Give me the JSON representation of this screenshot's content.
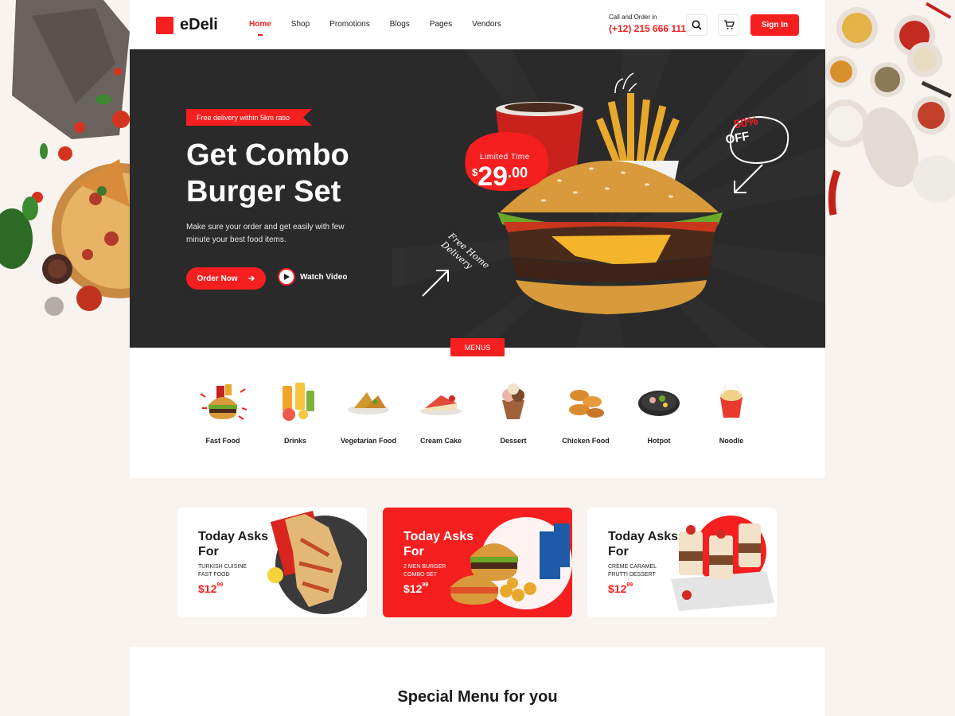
{
  "brand": {
    "name": "eDeli",
    "accent": "#f51f1f"
  },
  "nav": {
    "items": [
      {
        "label": "Home",
        "active": true
      },
      {
        "label": "Shop"
      },
      {
        "label": "Promotions"
      },
      {
        "label": "Blogs"
      },
      {
        "label": "Pages"
      },
      {
        "label": "Vendors"
      }
    ]
  },
  "header": {
    "call_label": "Call and Order in",
    "phone": "(+12) 215 666 111",
    "search_icon": "search-icon",
    "cart_icon": "cart-icon",
    "signin_label": "Sign In"
  },
  "hero": {
    "tag": "Free delivery within 5km ratio",
    "title_line1": "Get Combo",
    "title_line2": "Burger Set",
    "description": "Make sure your order and get easily with few minute your best food items.",
    "order_label": "Order Now",
    "watch_label": "Watch Video",
    "price_label": "Limited Time",
    "price_currency": "$",
    "price_dollars": "29",
    "price_cents": ".00",
    "off_percent": "50%",
    "off_label": "OFF",
    "delivery_note_line1": "Free Home",
    "delivery_note_line2": "Delivery"
  },
  "menus_tab": "MENUS",
  "categories": [
    {
      "label": "Fast Food"
    },
    {
      "label": "Drinks"
    },
    {
      "label": "Vegetarian Food"
    },
    {
      "label": "Cream Cake"
    },
    {
      "label": "Dessert"
    },
    {
      "label": "Chicken Food"
    },
    {
      "label": "Hotpot"
    },
    {
      "label": "Noodle"
    }
  ],
  "promos": [
    {
      "title": "Today Asks For",
      "sub_line1": "TURKISH CUISINE",
      "sub_line2": "FAST FOOD",
      "price": "$12",
      "cents": "99"
    },
    {
      "title": "Today Asks For",
      "sub_line1": "2 MEN BURGER",
      "sub_line2": "COMBO SET",
      "price": "$12",
      "cents": "99"
    },
    {
      "title": "Today Asks For",
      "sub_line1": "CRÈME CARAMEL",
      "sub_line2": "FRUTTI DESSERT",
      "price": "$12",
      "cents": "99"
    }
  ],
  "special": {
    "title": "Special Menu for you"
  }
}
